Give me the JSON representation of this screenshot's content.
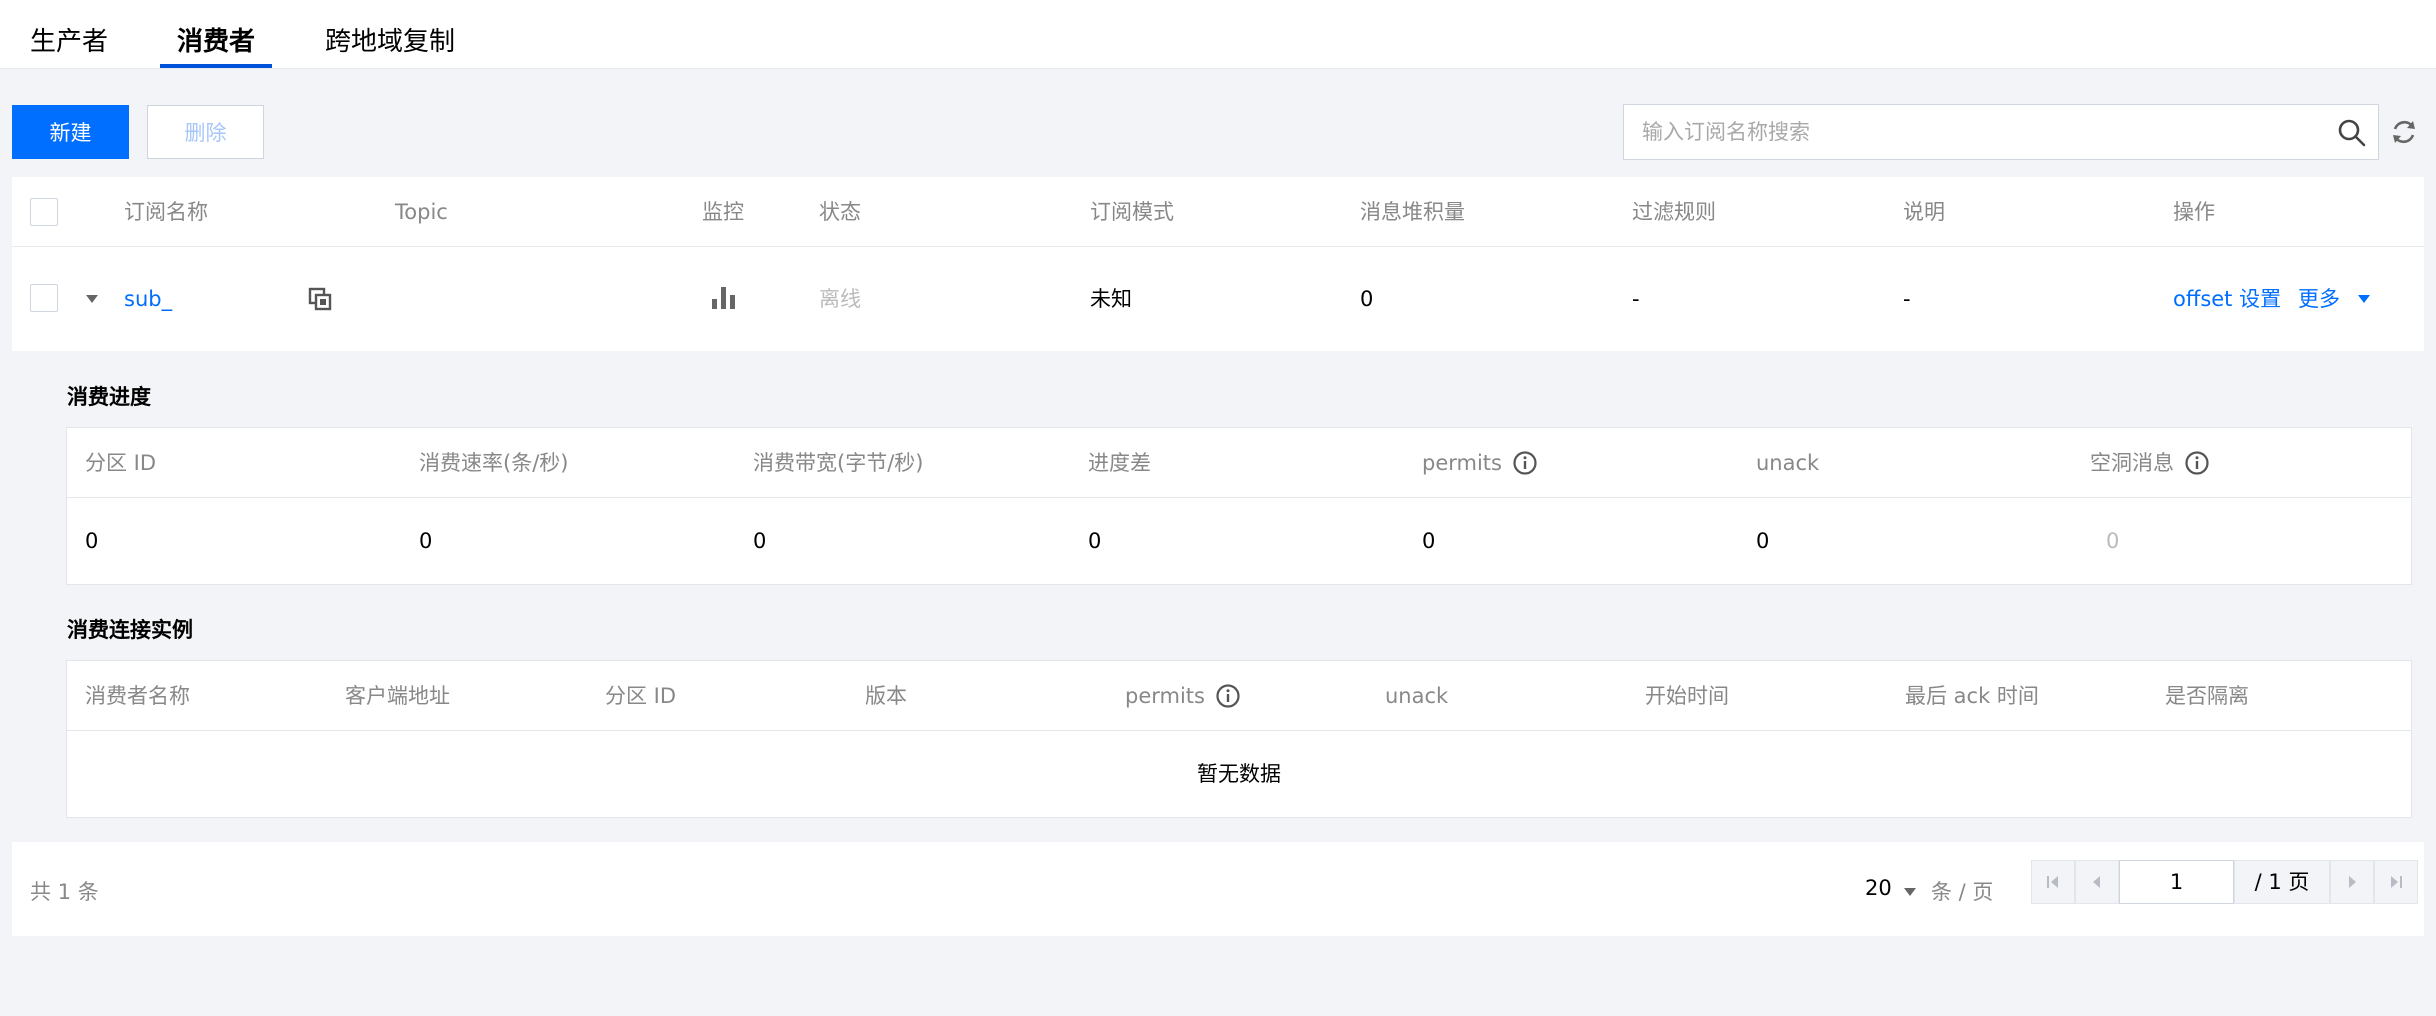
{
  "tabs": [
    {
      "label": "生产者",
      "active": false
    },
    {
      "label": "消费者",
      "active": true
    },
    {
      "label": "跨地域复制",
      "active": false
    }
  ],
  "toolbar": {
    "new_label": "新建",
    "delete_label": "删除",
    "search_placeholder": "输入订阅名称搜索"
  },
  "table": {
    "headers": [
      "订阅名称",
      "Topic",
      "监控",
      "状态",
      "订阅模式",
      "消息堆积量",
      "过滤规则",
      "说明",
      "操作"
    ],
    "row": {
      "name": "sub_",
      "status": "离线",
      "mode": "未知",
      "backlog": "0",
      "filter": "-",
      "desc": "-",
      "action_offset": "offset 设置",
      "action_more": "更多"
    }
  },
  "progress": {
    "title": "消费进度",
    "headers": [
      "分区 ID",
      "消费速率(条/秒)",
      "消费带宽(字节/秒)",
      "进度差",
      "permits",
      "unack",
      "空洞消息"
    ],
    "values": [
      "0",
      "0",
      "0",
      "0",
      "0",
      "0",
      "0"
    ]
  },
  "instances": {
    "title": "消费连接实例",
    "headers": [
      "消费者名称",
      "客户端地址",
      "分区 ID",
      "版本",
      "permits",
      "unack",
      "开始时间",
      "最后 ack 时间",
      "是否隔离"
    ],
    "empty": "暂无数据"
  },
  "footer": {
    "total_prefix": "共",
    "total_count": "1",
    "total_suffix": "条",
    "page_size": "20",
    "per_page": "条 / 页",
    "page_current": "1",
    "page_total": "/ 1 页"
  },
  "colors": {
    "primary": "#006eff",
    "tab_underline": "#0052d9"
  }
}
